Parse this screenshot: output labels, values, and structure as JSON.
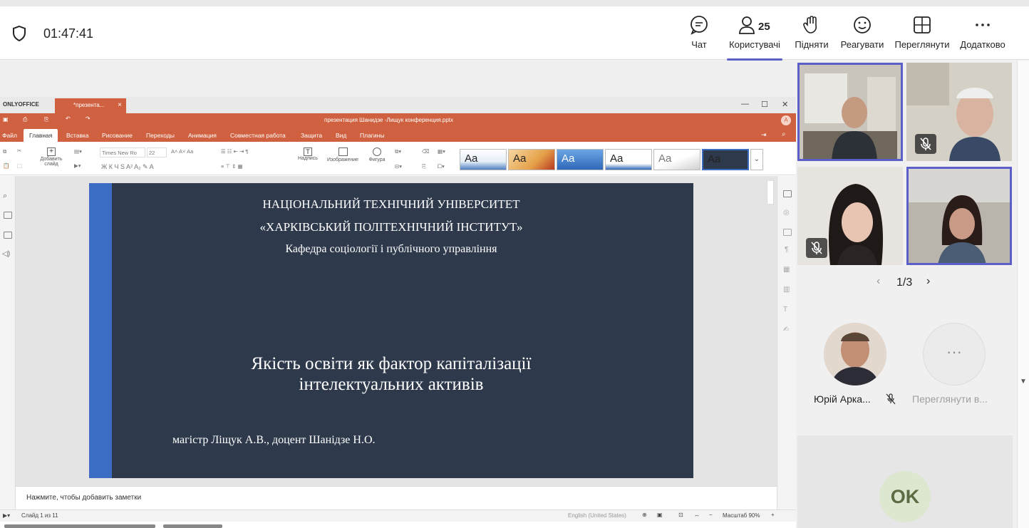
{
  "meeting": {
    "timer": "01:47:41",
    "people_count": "25",
    "toolbar": {
      "chat": "Чат",
      "people": "Користувачі",
      "raise": "Підняти",
      "react": "Реагувати",
      "view": "Переглянути",
      "more": "Додатково"
    }
  },
  "onlyoffice": {
    "logo": "ONLYOFFICE",
    "tab_label": "*презента...",
    "doc_title": "презентация Шанидзе -Лищук конференция.pptx",
    "user_initial": "A",
    "menu": [
      "Файл",
      "Главная",
      "Вставка",
      "Рисование",
      "Переходы",
      "Анимация",
      "Совместная работа",
      "Защита",
      "Вид",
      "Плагины"
    ],
    "ribbon": {
      "add_slide": "Добавить слайд",
      "font_name": "Times New Ro",
      "font_size": "22",
      "text_box": "Надпись",
      "image": "Изображение",
      "shape": "Фигура",
      "theme_sample": "Aa"
    },
    "notes_placeholder": "Нажмите, чтобы добавить заметки",
    "status": {
      "slide_counter": "Слайд 1 из 11",
      "language": "English (United States)",
      "zoom": "Масштаб 90%"
    }
  },
  "slide": {
    "line1": "НАЦІОНАЛЬНИЙ ТЕХНІЧНИЙ УНІВЕРСИТЕТ",
    "line2": "«ХАРКІВСЬКИЙ ПОЛІТЕХНІЧНИЙ ІНСТИТУТ»",
    "line3": "Кафедра соціології і публічного управління",
    "title1": "Якість освіти як фактор капіталізації",
    "title2": "інтелектуальних активів",
    "authors": "магістр Ліщук А.В.,  доцент Шанідзе Н.О."
  },
  "participants": {
    "pager": "1/3",
    "person1_name": "Юрій Арка...",
    "view_all": "Переглянути в...",
    "ok_initials": "OK"
  },
  "colors": {
    "accent": "#5b5fc7",
    "onlyoffice_brand": "#cf6141",
    "slide_background": "#2e3a4c",
    "slide_bar": "#3c6cc4"
  }
}
